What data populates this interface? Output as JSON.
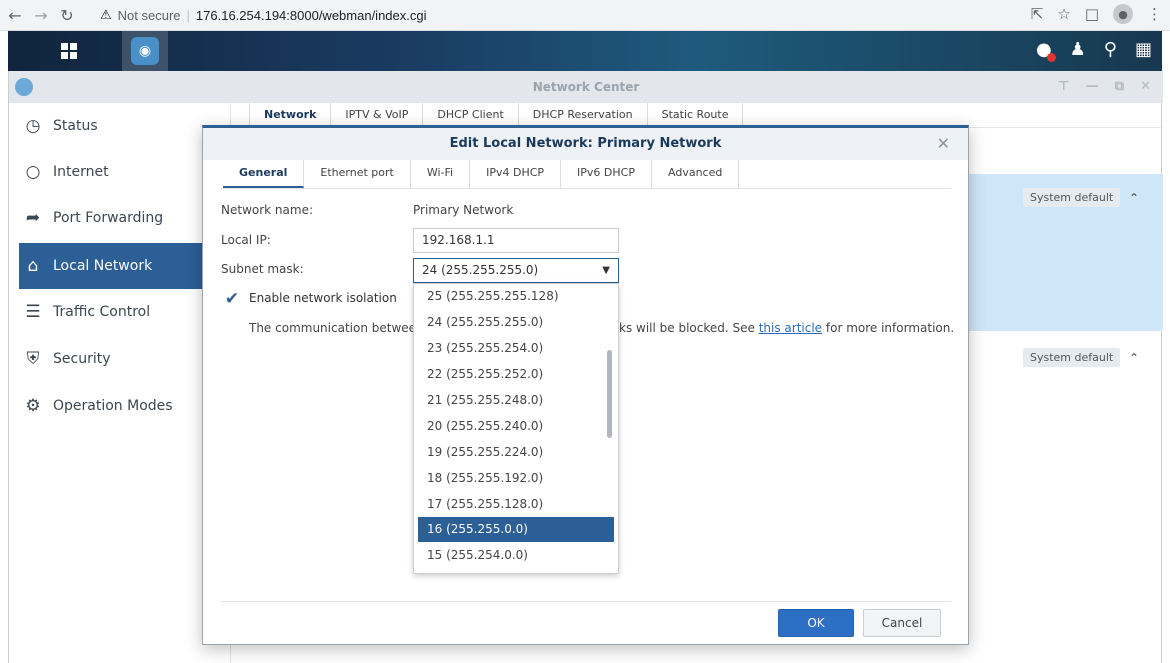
{
  "browser": {
    "security_warning": "Not secure",
    "url": "176.16.254.194:8000/webman/index.cgi"
  },
  "window": {
    "title": "Network Center"
  },
  "sidebar": {
    "items": [
      {
        "label": "Status",
        "icon": "clock-icon"
      },
      {
        "label": "Internet",
        "icon": "globe-icon"
      },
      {
        "label": "Port Forwarding",
        "icon": "arrow-icon"
      },
      {
        "label": "Local Network",
        "icon": "home-network-icon",
        "active": true
      },
      {
        "label": "Traffic Control",
        "icon": "sliders-icon"
      },
      {
        "label": "Security",
        "icon": "shield-icon"
      },
      {
        "label": "Operation Modes",
        "icon": "router-gear-icon"
      }
    ]
  },
  "content_tabs": [
    "Network",
    "IPTV & VoIP",
    "DHCP Client",
    "DHCP Reservation",
    "Static Route"
  ],
  "badges": {
    "system_default_1": "System default",
    "system_default_2": "System default"
  },
  "dialog": {
    "title": "Edit Local Network: Primary Network",
    "tabs": [
      "General",
      "Ethernet port",
      "Wi-Fi",
      "IPv4 DHCP",
      "IPv6 DHCP",
      "Advanced"
    ],
    "network_name_label": "Network name:",
    "network_name_value": "Primary Network",
    "local_ip_label": "Local IP:",
    "local_ip_value": "192.168.1.1",
    "subnet_label": "Subnet mask:",
    "subnet_value": "24 (255.255.255.0)",
    "isolation_label": "Enable network isolation",
    "isolation_checked": true,
    "desc_start": "The communication between",
    "desc_end_pre": "ks will be blocked. See ",
    "desc_link": "this article",
    "desc_end_post": " for more information.",
    "ok": "OK",
    "cancel": "Cancel"
  },
  "dropdown": {
    "options": [
      "25 (255.255.255.128)",
      "24 (255.255.255.0)",
      "23 (255.255.254.0)",
      "22 (255.255.252.0)",
      "21 (255.255.248.0)",
      "20 (255.255.240.0)",
      "19 (255.255.224.0)",
      "18 (255.255.192.0)",
      "17 (255.255.128.0)",
      "16 (255.255.0.0)",
      "15 (255.254.0.0)"
    ],
    "highlighted": "16 (255.255.0.0)"
  }
}
